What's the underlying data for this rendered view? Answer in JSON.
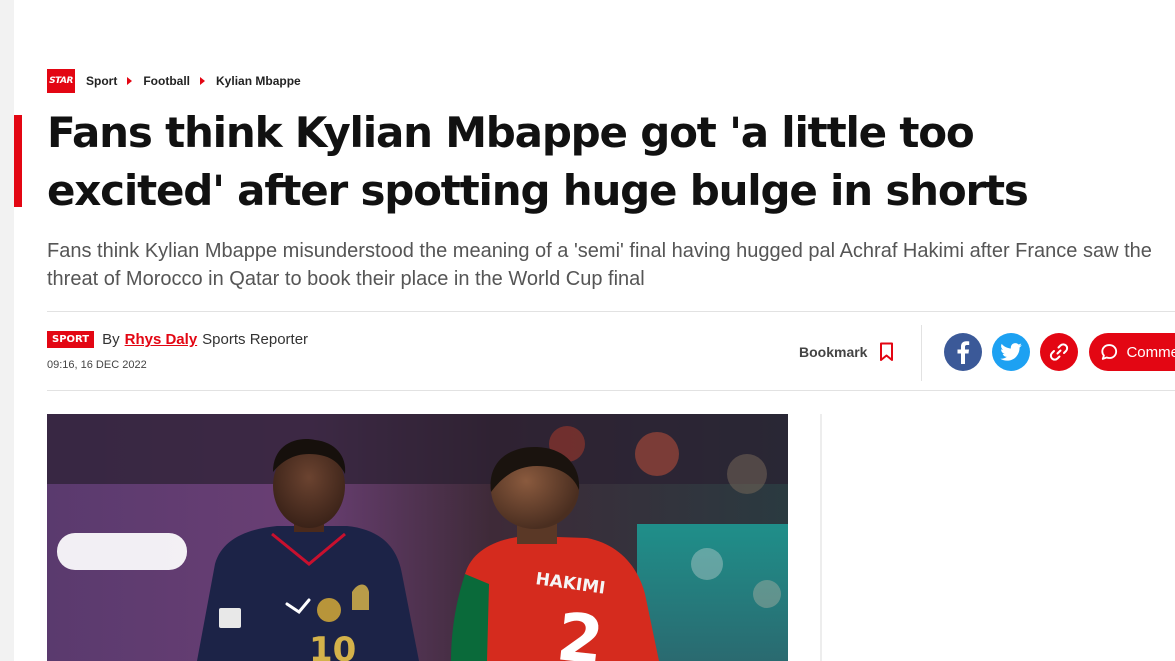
{
  "breadcrumb": {
    "logo_text": "STAR",
    "items": [
      "Sport",
      "Football",
      "Kylian Mbappe"
    ]
  },
  "headline": "Fans think Kylian Mbappe got 'a little too excited' after spotting huge bulge in shorts",
  "standfirst": "Fans think Kylian Mbappe misunderstood the meaning of a 'semi' final having hugged pal Achraf Hakimi after France saw the threat of Morocco in Qatar to book their place in the World Cup final",
  "byline": {
    "tag": "SPORT",
    "by": "By",
    "author": "Rhys Daly",
    "role": "Sports Reporter",
    "date": "09:16, 16 DEC 2022"
  },
  "actions": {
    "bookmark_label": "Bookmark",
    "comments_label": "Comments"
  },
  "hero": {
    "shirt_name": "HAKIMI",
    "shirt_number": "2",
    "player_number": "10"
  },
  "colors": {
    "brand_red": "#e30613",
    "facebook": "#3b5998",
    "twitter": "#1da1f2"
  },
  "icons": {
    "facebook": "facebook-icon",
    "twitter": "twitter-icon",
    "link": "link-icon",
    "comment": "comment-icon",
    "bookmark": "bookmark-icon"
  }
}
